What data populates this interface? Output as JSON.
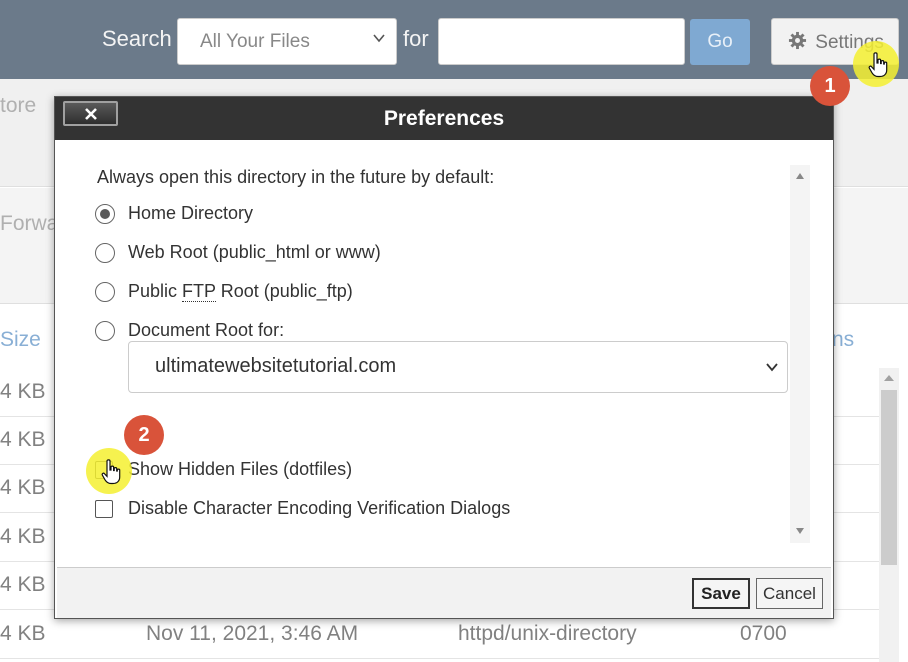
{
  "toolbar": {
    "search_label": "Search",
    "scope_value": "All Your Files",
    "for_label": "for",
    "search_value": "",
    "go_label": "Go",
    "settings_label": "Settings"
  },
  "background": {
    "store_fragment": "tore",
    "forward_fragment": "Forwa",
    "col_size": "Size",
    "col_perms_fragment": "ns",
    "rows": [
      {
        "size": "4 KB",
        "date": "",
        "type": "",
        "perms": ""
      },
      {
        "size": "4 KB",
        "date": "",
        "type": "",
        "perms": ""
      },
      {
        "size": "4 KB",
        "date": "",
        "type": "",
        "perms": ""
      },
      {
        "size": "4 KB",
        "date": "",
        "type": "",
        "perms": ""
      },
      {
        "size": "4 KB",
        "date": "",
        "type": "",
        "perms": ""
      },
      {
        "size": "4 KB",
        "date": "Nov 11, 2021, 3:46 AM",
        "type": "httpd/unix-directory",
        "perms": "0700"
      }
    ]
  },
  "dialog": {
    "title": "Preferences",
    "heading": "Always open this directory in the future by default:",
    "options": {
      "home": {
        "label": "Home Directory",
        "checked": true
      },
      "webroot": {
        "label": "Web Root (public_html or www)",
        "checked": false
      },
      "ftp_prefix": "Public ",
      "ftp_abbr": "FTP",
      "ftp_suffix": " Root (public_ftp)",
      "docroot": {
        "label": "Document Root for:",
        "checked": false
      }
    },
    "docroot_domain": "ultimatewebsitetutorial.com",
    "show_hidden": {
      "label": "Show Hidden Files (dotfiles)",
      "checked": true
    },
    "disable_encoding": {
      "label": "Disable Character Encoding Verification Dialogs",
      "checked": false
    },
    "save_label": "Save",
    "cancel_label": "Cancel"
  },
  "annotations": {
    "step1": "1",
    "step2": "2",
    "badge_color": "#d9533a",
    "highlight_color": "#f4f030"
  }
}
